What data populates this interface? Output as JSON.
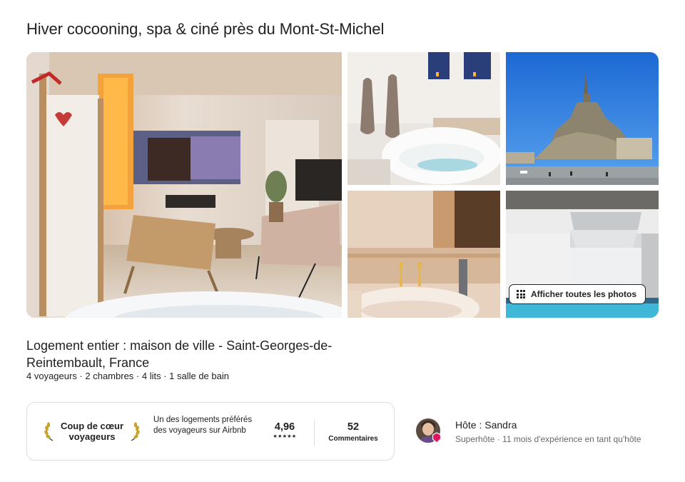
{
  "listing": {
    "title": "Hiver cocooning, spa & ciné près du Mont-St-Michel",
    "subtitle": "Logement entier : maison de ville - Saint-Georges-de-Reintembault, France",
    "details": "4 voyageurs · 2 chambres · 4 lits · 1 salle de bain"
  },
  "gallery": {
    "show_all_label": "Afficher toutes les photos"
  },
  "guest_favorite": {
    "badge_line1": "Coup de cœur",
    "badge_line2": "voyageurs",
    "description": "Un des logements préférés des voyageurs sur Airbnb",
    "rating": "4,96",
    "stars": "★★★★★",
    "reviews_count": "52",
    "reviews_label": "Commentaires"
  },
  "host": {
    "name": "Hôte : Sandra",
    "meta": "Superhôte · 11 mois d'expérience en tant qu'hôte"
  },
  "colors": {
    "text": "#222222",
    "muted": "#6a6a6a",
    "border": "#dddddd",
    "superhost_accent": "#e01561"
  }
}
